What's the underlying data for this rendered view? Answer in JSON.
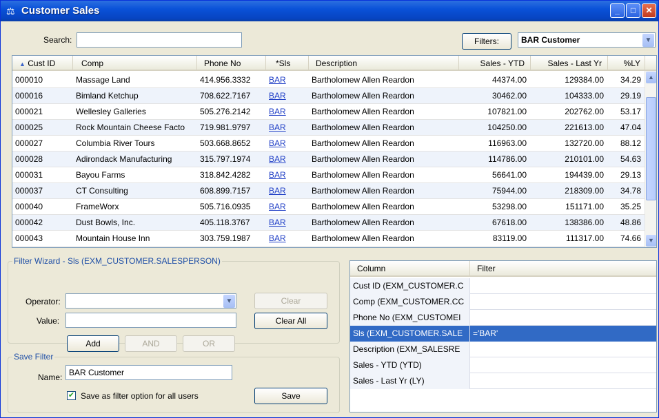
{
  "window": {
    "title": "Customer Sales"
  },
  "search": {
    "label": "Search:",
    "value": ""
  },
  "filters": {
    "button_label": "Filters:",
    "selected": "BAR Customer"
  },
  "grid": {
    "columns": [
      "Cust ID",
      "Comp",
      "Phone No",
      "*Sls",
      "Description",
      "Sales - YTD",
      "Sales - Last Yr",
      "%LY"
    ],
    "sort_indicator": "▲",
    "rows": [
      {
        "id": "000010",
        "comp": "Massage Land",
        "phone": "414.956.3332",
        "sls": "BAR",
        "desc": "Bartholomew Allen Reardon",
        "ytd": "44374.00",
        "ly": "129384.00",
        "pct": "34.29"
      },
      {
        "id": "000016",
        "comp": "Bimland Ketchup",
        "phone": "708.622.7167",
        "sls": "BAR",
        "desc": "Bartholomew Allen Reardon",
        "ytd": "30462.00",
        "ly": "104333.00",
        "pct": "29.19"
      },
      {
        "id": "000021",
        "comp": "Wellesley Galleries",
        "phone": "505.276.2142",
        "sls": "BAR",
        "desc": "Bartholomew Allen Reardon",
        "ytd": "107821.00",
        "ly": "202762.00",
        "pct": "53.17"
      },
      {
        "id": "000025",
        "comp": "Rock Mountain Cheese Facto",
        "phone": "719.981.9797",
        "sls": "BAR",
        "desc": "Bartholomew Allen Reardon",
        "ytd": "104250.00",
        "ly": "221613.00",
        "pct": "47.04"
      },
      {
        "id": "000027",
        "comp": "Columbia River Tours",
        "phone": "503.668.8652",
        "sls": "BAR",
        "desc": "Bartholomew Allen Reardon",
        "ytd": "116963.00",
        "ly": "132720.00",
        "pct": "88.12"
      },
      {
        "id": "000028",
        "comp": "Adirondack Manufacturing",
        "phone": "315.797.1974",
        "sls": "BAR",
        "desc": "Bartholomew Allen Reardon",
        "ytd": "114786.00",
        "ly": "210101.00",
        "pct": "54.63"
      },
      {
        "id": "000031",
        "comp": "Bayou Farms",
        "phone": "318.842.4282",
        "sls": "BAR",
        "desc": "Bartholomew Allen Reardon",
        "ytd": "56641.00",
        "ly": "194439.00",
        "pct": "29.13"
      },
      {
        "id": "000037",
        "comp": "CT Consulting",
        "phone": "608.899.7157",
        "sls": "BAR",
        "desc": "Bartholomew Allen Reardon",
        "ytd": "75944.00",
        "ly": "218309.00",
        "pct": "34.78"
      },
      {
        "id": "000040",
        "comp": "FrameWorx",
        "phone": "505.716.0935",
        "sls": "BAR",
        "desc": "Bartholomew Allen Reardon",
        "ytd": "53298.00",
        "ly": "151171.00",
        "pct": "35.25"
      },
      {
        "id": "000042",
        "comp": "Dust Bowls, Inc.",
        "phone": "405.118.3767",
        "sls": "BAR",
        "desc": "Bartholomew Allen Reardon",
        "ytd": "67618.00",
        "ly": "138386.00",
        "pct": "48.86"
      },
      {
        "id": "000043",
        "comp": "Mountain House Inn",
        "phone": "303.759.1987",
        "sls": "BAR",
        "desc": "Bartholomew Allen Reardon",
        "ytd": "83119.00",
        "ly": "111317.00",
        "pct": "74.66"
      }
    ]
  },
  "wizard": {
    "title": "Filter Wizard - Sls (EXM_CUSTOMER.SALESPERSON)",
    "operator_label": "Operator:",
    "operator_value": "",
    "value_label": "Value:",
    "value_value": "",
    "clear_label": "Clear",
    "clear_all_label": "Clear All",
    "add_label": "Add",
    "and_label": "AND",
    "or_label": "OR"
  },
  "save": {
    "title": "Save Filter",
    "name_label": "Name:",
    "name_value": "BAR Customer",
    "option_label": "Save as filter option for all users",
    "option_checked": true,
    "save_label": "Save"
  },
  "filter_grid": {
    "columns": [
      "Column",
      "Filter"
    ],
    "rows": [
      {
        "column": "Cust ID (EXM_CUSTOMER.C",
        "filter": ""
      },
      {
        "column": "Comp (EXM_CUSTOMER.CC",
        "filter": ""
      },
      {
        "column": "Phone No (EXM_CUSTOMEI",
        "filter": ""
      },
      {
        "column": "Sls (EXM_CUSTOMER.SALE",
        "filter": "='BAR'"
      },
      {
        "column": "Description (EXM_SALESRE",
        "filter": ""
      },
      {
        "column": "Sales - YTD (YTD)",
        "filter": ""
      },
      {
        "column": "Sales - Last Yr (LY)",
        "filter": ""
      }
    ],
    "selected_index": 3
  },
  "colors": {
    "titlebar": "#0a52d8",
    "selection": "#316ac5",
    "link": "#1f3ec6"
  }
}
